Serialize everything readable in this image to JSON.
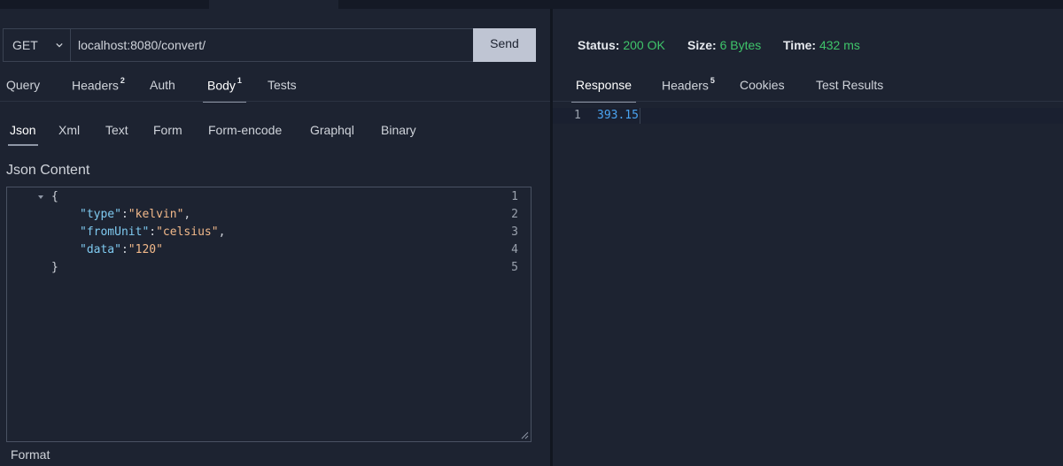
{
  "request": {
    "method": "GET",
    "url": "localhost:8080/convert/",
    "send_label": "Send"
  },
  "request_tabs": [
    {
      "label": "Query",
      "count": ""
    },
    {
      "label": "Headers",
      "count": "2"
    },
    {
      "label": "Auth",
      "count": ""
    },
    {
      "label": "Body",
      "count": "1"
    },
    {
      "label": "Tests",
      "count": ""
    }
  ],
  "active_request_tab": "Body",
  "body_types": [
    "Json",
    "Xml",
    "Text",
    "Form",
    "Form-encode",
    "Graphql",
    "Binary"
  ],
  "active_body_type": "Json",
  "editor": {
    "label": "Json Content",
    "lines": [
      {
        "n": "1",
        "text": "{"
      },
      {
        "n": "2",
        "key": "\"type\"",
        "colon": ":",
        "value": "\"kelvin\"",
        "tail": ","
      },
      {
        "n": "3",
        "key": "\"fromUnit\"",
        "colon": ":",
        "value": "\"celsius\"",
        "tail": ","
      },
      {
        "n": "4",
        "key": "\"data\"",
        "colon": ":",
        "value": "\"120\"",
        "tail": ""
      },
      {
        "n": "5",
        "text": "}"
      }
    ]
  },
  "format_label": "Format",
  "response_status": {
    "status_label": "Status:",
    "status_value": "200 OK",
    "size_label": "Size:",
    "size_value": "6 Bytes",
    "time_label": "Time:",
    "time_value": "432 ms"
  },
  "response_tabs": [
    {
      "label": "Response",
      "count": ""
    },
    {
      "label": "Headers",
      "count": "5"
    },
    {
      "label": "Cookies",
      "count": ""
    },
    {
      "label": "Test Results",
      "count": ""
    }
  ],
  "active_response_tab": "Response",
  "response_body": {
    "line_number": "1",
    "value": "393.15"
  },
  "colors": {
    "background": "#1d2331",
    "send_button": "#bfc5d3",
    "success": "#3fc46a",
    "json_key": "#7fcaf0",
    "json_string": "#f2b98a",
    "response_number": "#4aa3f0"
  }
}
